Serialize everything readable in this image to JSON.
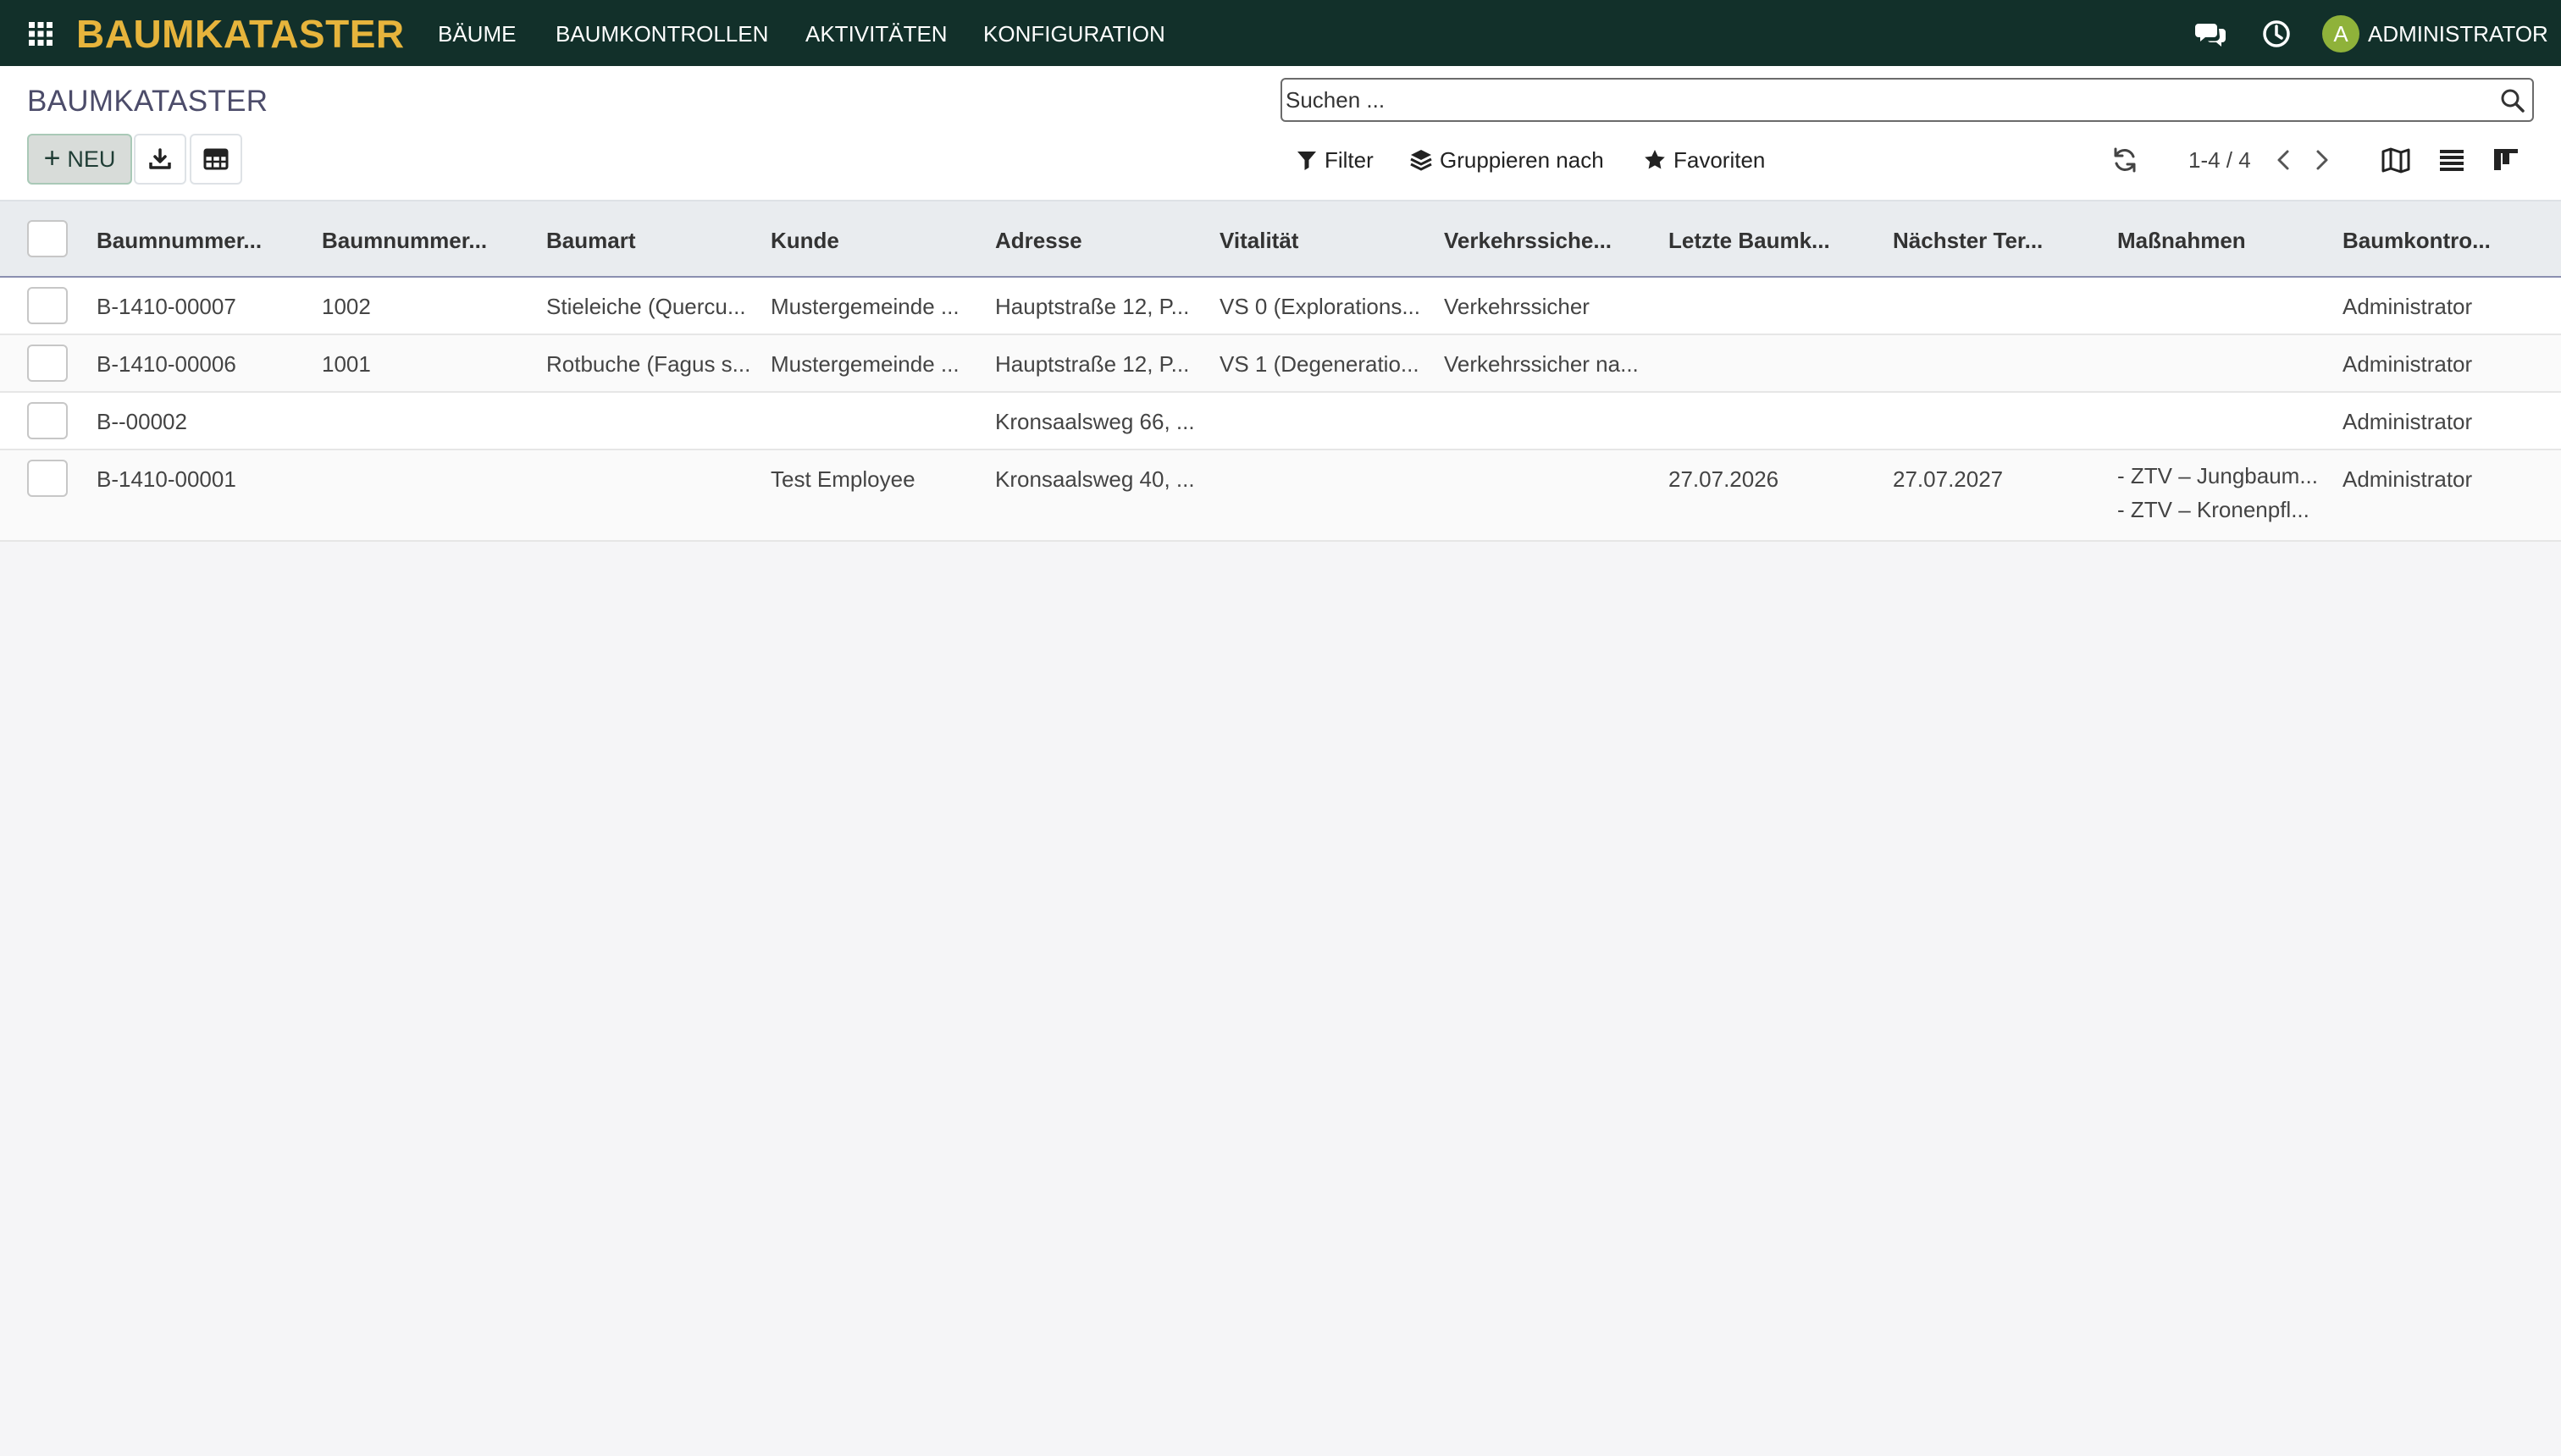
{
  "navbar": {
    "brand": "BAUMKATASTER",
    "menu": [
      "BÄUME",
      "BAUMKONTROLLEN",
      "AKTIVITÄTEN",
      "KONFIGURATION"
    ],
    "user_initial": "A",
    "user_name": "ADMINISTRATOR"
  },
  "control_panel": {
    "title": "BAUMKATASTER",
    "new_button": "NEU",
    "search_placeholder": "Suchen ...",
    "filter": "Filter",
    "group_by": "Gruppieren nach",
    "favorites": "Favoriten",
    "pager": "1-4 / 4"
  },
  "table": {
    "columns": [
      "Baumnummer...",
      "Baumnummer...",
      "Baumart",
      "Kunde",
      "Adresse",
      "Vitalität",
      "Verkehrssiche...",
      "Letzte Baumk...",
      "Nächster Ter...",
      "Maßnahmen",
      "Baumkontro..."
    ],
    "rows": [
      {
        "c0": "B-1410-00007",
        "c1": "1002",
        "c2": "Stieleiche (Quercu...",
        "c3": "Mustergemeinde ...",
        "c4": "Hauptstraße 12, P...",
        "c5": "VS 0 (Explorations...",
        "c6": "Verkehrssicher",
        "c7": "",
        "c8": "",
        "c9a": "",
        "c9b": "",
        "c10": "Administrator"
      },
      {
        "c0": "B-1410-00006",
        "c1": "1001",
        "c2": "Rotbuche (Fagus s...",
        "c3": "Mustergemeinde ...",
        "c4": "Hauptstraße 12, P...",
        "c5": "VS 1 (Degeneratio...",
        "c6": "Verkehrssicher na...",
        "c7": "",
        "c8": "",
        "c9a": "",
        "c9b": "",
        "c10": "Administrator"
      },
      {
        "c0": "B--00002",
        "c1": "",
        "c2": "",
        "c3": "",
        "c4": "Kronsaalsweg 66, ...",
        "c5": "",
        "c6": "",
        "c7": "",
        "c8": "",
        "c9a": "",
        "c9b": "",
        "c10": "Administrator"
      },
      {
        "c0": "B-1410-00001",
        "c1": "",
        "c2": "",
        "c3": "Test Employee",
        "c4": "Kronsaalsweg 40, ...",
        "c5": "",
        "c6": "",
        "c7": "27.07.2026",
        "c8": "27.07.2027",
        "c9a": "- ZTV – Jungbaum...",
        "c9b": "- ZTV – Kronenpfl...",
        "c10": "Administrator"
      }
    ]
  },
  "colors": {
    "navbar_bg": "#12302a",
    "brand": "#e6b43c",
    "avatar": "#8fb23a"
  },
  "icons": [
    "apps-grid-icon",
    "chat-icon",
    "clock-icon",
    "download-icon",
    "spreadsheet-icon",
    "search-icon",
    "filter-icon",
    "layers-icon",
    "star-icon",
    "refresh-icon",
    "chevron-left-icon",
    "chevron-right-icon",
    "map-view-icon",
    "list-view-icon",
    "kanban-view-icon"
  ]
}
